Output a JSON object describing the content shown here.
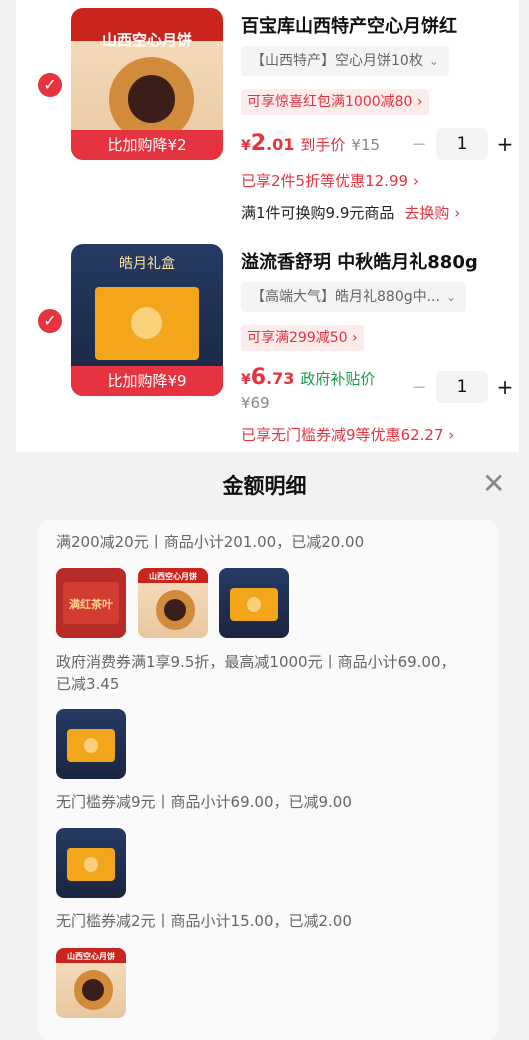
{
  "cart": {
    "items": [
      {
        "title": "百宝库山西特产空心月饼红",
        "spec": "【山西特产】空心月饼10枚",
        "promo": "可享惊喜红包满1000减80",
        "cheaper_label": "比加购降¥2",
        "price_yen": "¥",
        "price_int": "2",
        "price_dec": ".01",
        "price_tag": "到手价",
        "orig_price": "¥15",
        "qty": "1",
        "offer": "已享2件5折等优惠12.99",
        "swap_text": "满1件可换购9.9元商品",
        "swap_link": "去换购",
        "image_header": "山西空心月饼"
      },
      {
        "title": "溢流香舒玥 中秋皓月礼880g",
        "spec": "【高端大气】皓月礼880g中...",
        "promo": "可享满299减50",
        "cheaper_label": "比加购降¥9",
        "price_yen": "¥",
        "price_int": "6",
        "price_dec": ".73",
        "price_tag": "政府补贴价",
        "orig_price": "¥69",
        "qty": "1",
        "offer": "已享无门槛券减9等优惠62.27",
        "image_header": "皓月礼盒"
      }
    ]
  },
  "sheet": {
    "title": "金额明细",
    "sections": [
      {
        "text": "满200减20元丨商品小计201.00，已减20.00"
      },
      {
        "text": "政府消费券满1享9.5折，最高减1000元丨商品小计69.00，已减3.45"
      },
      {
        "text": "无门槛券减9元丨商品小计69.00，已减9.00"
      },
      {
        "text": "无门槛券减2元丨商品小计15.00，已减2.00"
      }
    ],
    "gift_label": "满红茶叶"
  },
  "colors": {
    "accent": "#e5333f",
    "promo_bg": "#fdecec",
    "text_dark": "#111111",
    "text_gray": "#666666"
  },
  "icons": {
    "check": "check-circle-icon",
    "close": "close-icon",
    "chevron": "chevron-right-icon",
    "minus": "minus-icon",
    "plus": "plus-icon"
  }
}
